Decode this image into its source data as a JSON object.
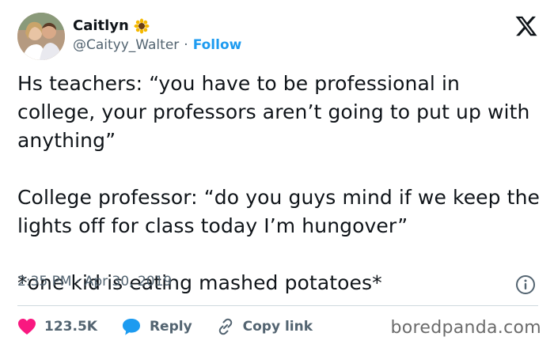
{
  "author": {
    "display_name": "Caitlyn",
    "handle": "@Caityy_Walter",
    "separator": "·",
    "follow_label": "Follow",
    "emoji_icon": "sunflower-icon"
  },
  "brand": {
    "logo": "x-logo-icon"
  },
  "tweet": {
    "text": "Hs teachers: “you have to be professional in college, your professors aren’t going to put up with anything”\n\nCollege professor: “do you guys mind if we keep the lights off for class today I’m hungover”\n\n*one kid is eating mashed potatoes*",
    "timestamp": "2:35 PM · Apr 30, 2019"
  },
  "actions": {
    "like_count": "123.5K",
    "reply_label": "Reply",
    "copy_link_label": "Copy link"
  },
  "watermark": "boredpanda.com",
  "colors": {
    "accent": "#1d9bf0",
    "like": "#f91880",
    "muted": "#536471",
    "text": "#0f1419"
  }
}
